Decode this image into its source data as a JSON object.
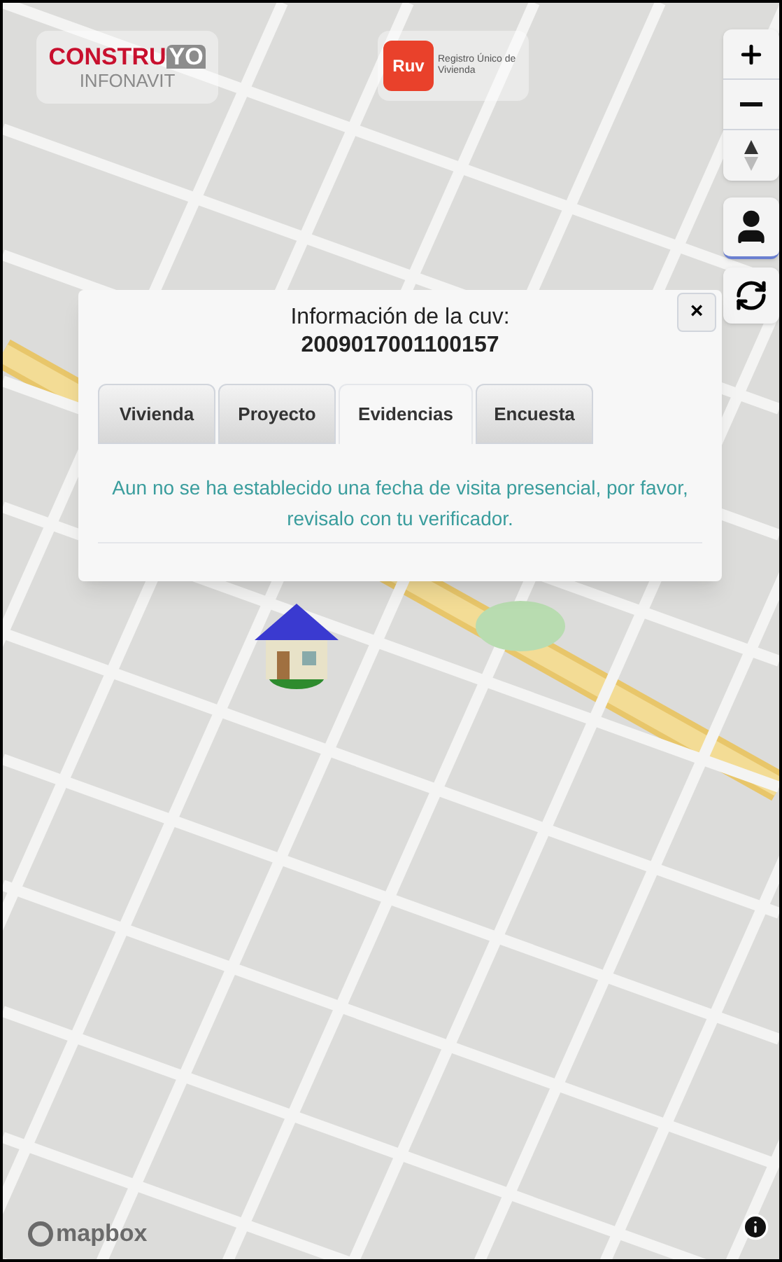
{
  "logos": {
    "construyo": {
      "text": "CONSTRU",
      "highlight": "YO",
      "subtitle": "INFONAVIT"
    },
    "ruv": {
      "text": "Ruv",
      "caption": "Registro Único de Vivienda"
    }
  },
  "popup": {
    "title": "Información de la cuv:",
    "cuv": "2009017001100157",
    "close": "×",
    "tabs": [
      {
        "label": "Vivienda",
        "selected": false
      },
      {
        "label": "Proyecto",
        "selected": false
      },
      {
        "label": "Evidencias",
        "selected": true
      },
      {
        "label": "Encuesta",
        "selected": false
      }
    ],
    "message": "Aun no se ha establecido una fecha de visita presencial, por favor, revisalo con tu verificador."
  },
  "attribution": {
    "logo": "mapbox"
  }
}
